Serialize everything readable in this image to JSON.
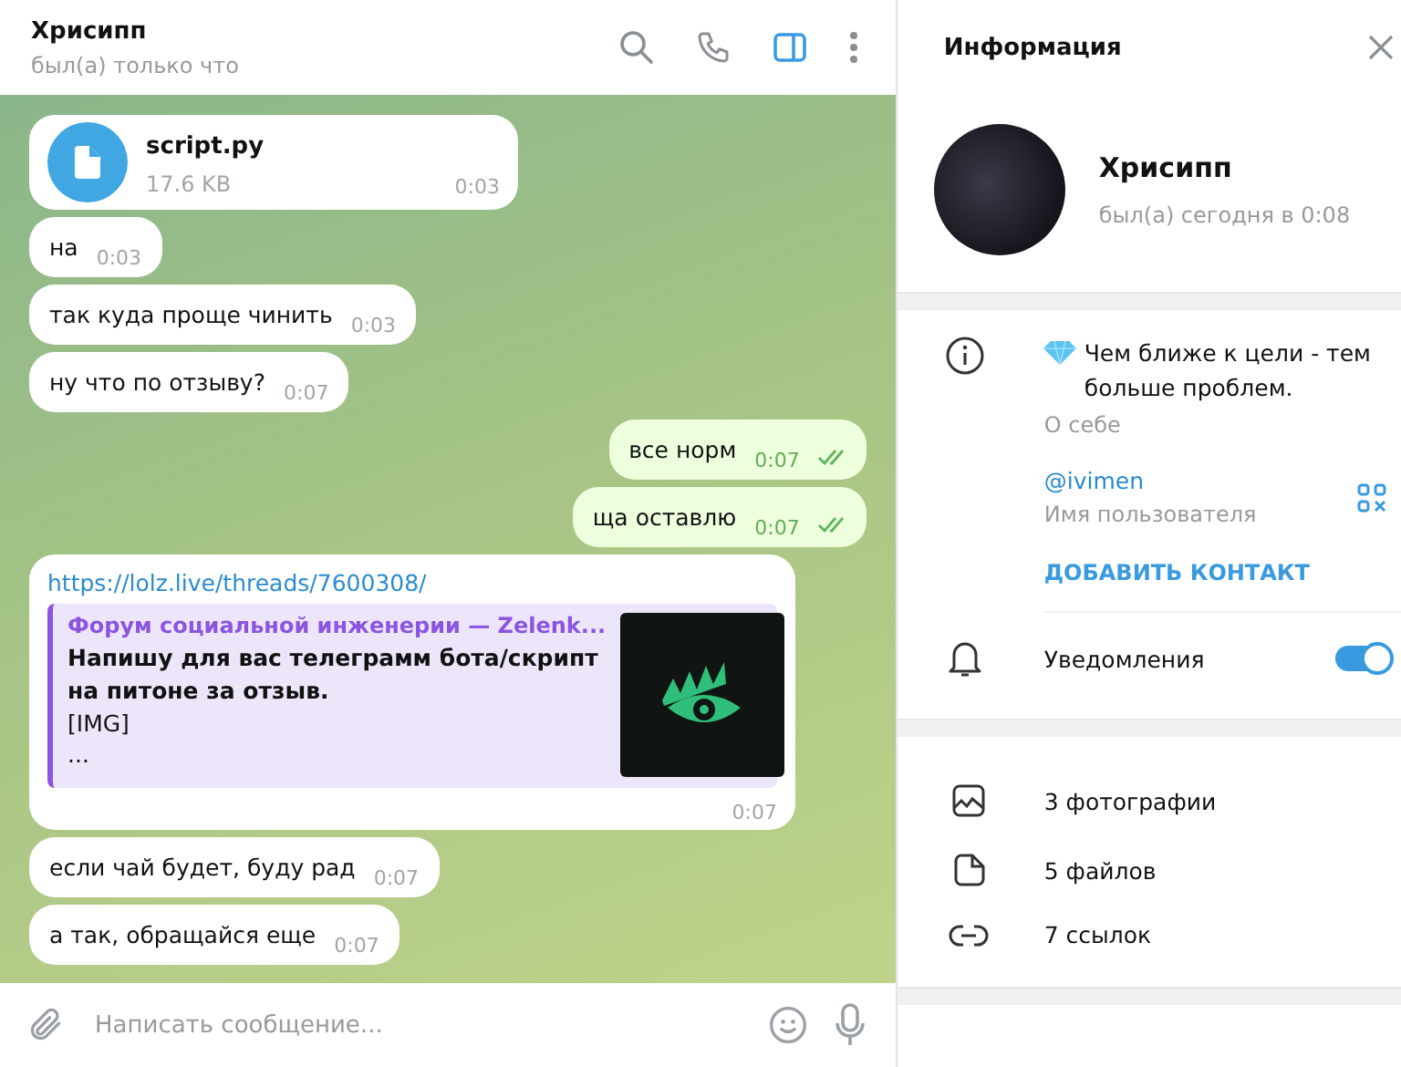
{
  "chat": {
    "title": "Хрисипп",
    "status": "был(а) только что",
    "messages": [
      {
        "kind": "file",
        "incoming": true,
        "file_name": "script.py",
        "file_size": "17.6 KB",
        "time": "0:03"
      },
      {
        "kind": "text",
        "incoming": true,
        "text": "на",
        "time": "0:03"
      },
      {
        "kind": "text",
        "incoming": true,
        "text": "так куда проще чинить",
        "time": "0:03"
      },
      {
        "kind": "text",
        "incoming": true,
        "text": "ну что по отзыву?",
        "time": "0:07"
      },
      {
        "kind": "text",
        "incoming": false,
        "text": "все норм",
        "time": "0:07",
        "read": true
      },
      {
        "kind": "text",
        "incoming": false,
        "text": "ща оставлю",
        "time": "0:07",
        "read": true
      },
      {
        "kind": "link",
        "incoming": true,
        "url": "https://lolz.live/threads/7600308/",
        "preview_site": "Форум социальной инженерии — Zelenk...",
        "preview_title": "Напишу для вас телеграмм бота/скрипт на питоне за отзыв.",
        "preview_lines": [
          "[IMG]",
          "..."
        ],
        "time": "0:07"
      },
      {
        "kind": "text",
        "incoming": true,
        "text": "если чай будет, буду рад",
        "time": "0:07"
      },
      {
        "kind": "text",
        "incoming": true,
        "text": "а так, обращайся еще",
        "time": "0:07"
      }
    ],
    "composer": {
      "placeholder": "Написать сообщение..."
    }
  },
  "info": {
    "title": "Информация",
    "name": "Хрисипп",
    "last_seen": "был(а) сегодня в 0:08",
    "bio": "Чем ближе к цели - тем больше проблем.",
    "bio_label": "О себе",
    "username": "@ivimen",
    "username_label": "Имя пользователя",
    "add_contact": "ДОБАВИТЬ КОНТАКТ",
    "notifications": {
      "label": "Уведомления",
      "on": true
    },
    "media": [
      {
        "kind": "photos",
        "label": "3 фотографии"
      },
      {
        "kind": "files",
        "label": "5 файлов"
      },
      {
        "kind": "links",
        "label": "7 ссылок"
      }
    ]
  }
}
